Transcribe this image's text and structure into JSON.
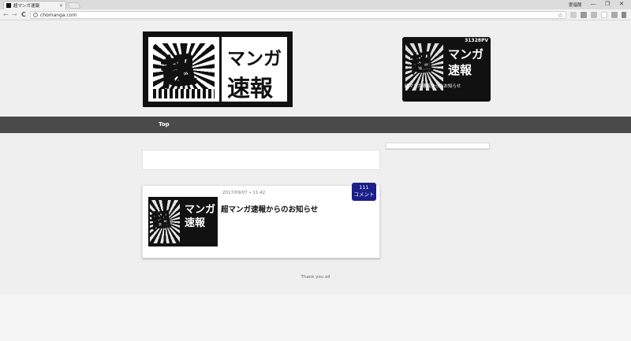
{
  "browser": {
    "tab_title": "超マンガ速報",
    "tab_close": "×",
    "user_label": "愛瑠蘭",
    "url": "chomanga.com",
    "window_controls": {
      "minimize": "—",
      "maximize": "❐",
      "close": "✕"
    },
    "nav": {
      "back": "←",
      "forward": "→",
      "reload": "C"
    },
    "icons": [
      "info-icon",
      "star-icon"
    ]
  },
  "logo": {
    "big_char": "超",
    "line1": "マンガ",
    "line2": "速報"
  },
  "counter": {
    "pv": "31328PV",
    "big_char": "超",
    "line1": "マンガ",
    "line2": "速報",
    "caption": "超マンガ速報からのお知らせ"
  },
  "nav": {
    "top_label": "Top"
  },
  "article": {
    "date": "2017/09/07",
    "sep": "•",
    "time": "11:42",
    "title": "超マンガ速報からのお知らせ",
    "comment_count": "111",
    "comment_label": "コメント",
    "thumb_char": "超",
    "thumb_line1": "マンガ",
    "thumb_line2": "速報"
  },
  "footer": {
    "text": "Thank you all"
  },
  "colors": {
    "navbar": "#4a4a4a",
    "badge": "#1b1f8a",
    "page_bg": "#efefef"
  }
}
